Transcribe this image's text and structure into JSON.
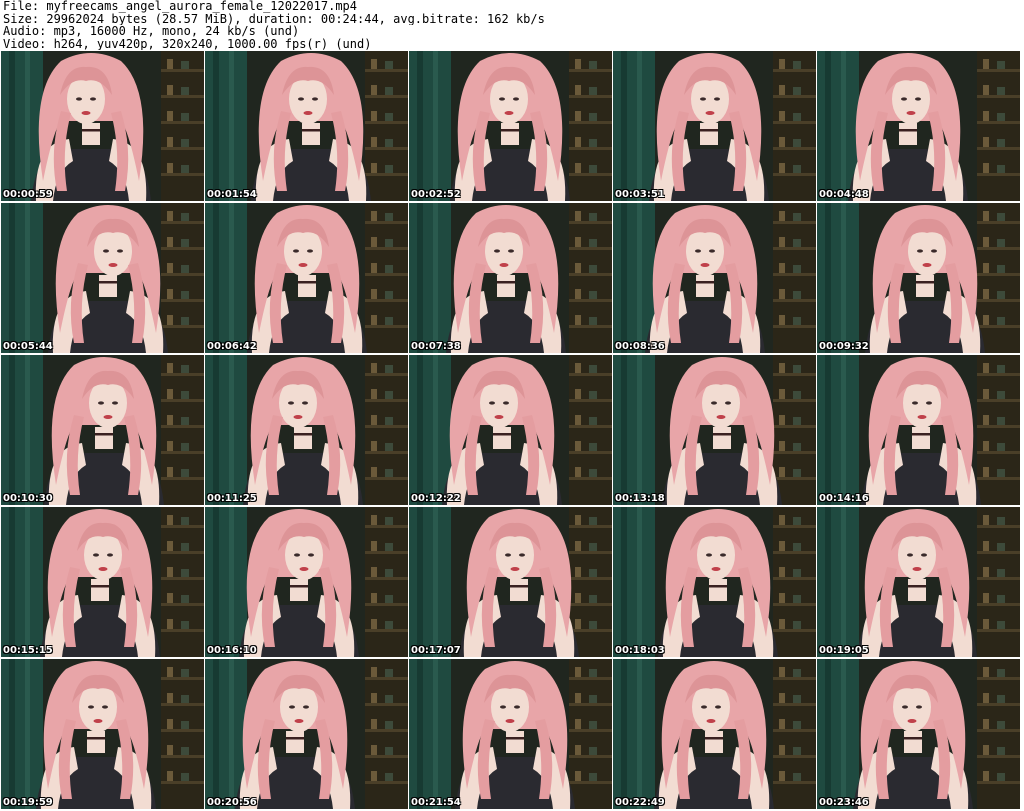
{
  "header": {
    "file_line": "File: myfreecams_angel_aurora_female_12022017.mp4",
    "size_line": "Size: 29962024 bytes (28.57 MiB), duration: 00:24:44, avg.bitrate: 162 kb/s",
    "audio_line": "Audio: mp3, 16000 Hz, mono, 24 kb/s (und)",
    "video_line": "Video: h264, yuv420p, 320x240, 1000.00 fps(r) (und)"
  },
  "grid": {
    "columns": 5,
    "rows": 5,
    "thumbnails": [
      {
        "timestamp": "00:00:59"
      },
      {
        "timestamp": "00:01:54"
      },
      {
        "timestamp": "00:02:52"
      },
      {
        "timestamp": "00:03:51"
      },
      {
        "timestamp": "00:04:48"
      },
      {
        "timestamp": "00:05:44"
      },
      {
        "timestamp": "00:06:42"
      },
      {
        "timestamp": "00:07:38"
      },
      {
        "timestamp": "00:08:36"
      },
      {
        "timestamp": "00:09:32"
      },
      {
        "timestamp": "00:10:30"
      },
      {
        "timestamp": "00:11:25"
      },
      {
        "timestamp": "00:12:22"
      },
      {
        "timestamp": "00:13:18"
      },
      {
        "timestamp": "00:14:16"
      },
      {
        "timestamp": "00:15:15"
      },
      {
        "timestamp": "00:16:10"
      },
      {
        "timestamp": "00:17:07"
      },
      {
        "timestamp": "00:18:03"
      },
      {
        "timestamp": "00:19:05"
      },
      {
        "timestamp": "00:19:59"
      },
      {
        "timestamp": "00:20:56"
      },
      {
        "timestamp": "00:21:54"
      },
      {
        "timestamp": "00:22:49"
      },
      {
        "timestamp": "00:23:46"
      }
    ]
  },
  "colors": {
    "background": "#ffffff",
    "text": "#000000",
    "timestamp_text": "#ffffff",
    "timestamp_outline": "#000000",
    "hair": "#e8a5a8",
    "skin": "#f2dcd2",
    "curtain": "#1f4a40",
    "room_dark": "#20261f",
    "top_garment": "#2a2a30"
  }
}
